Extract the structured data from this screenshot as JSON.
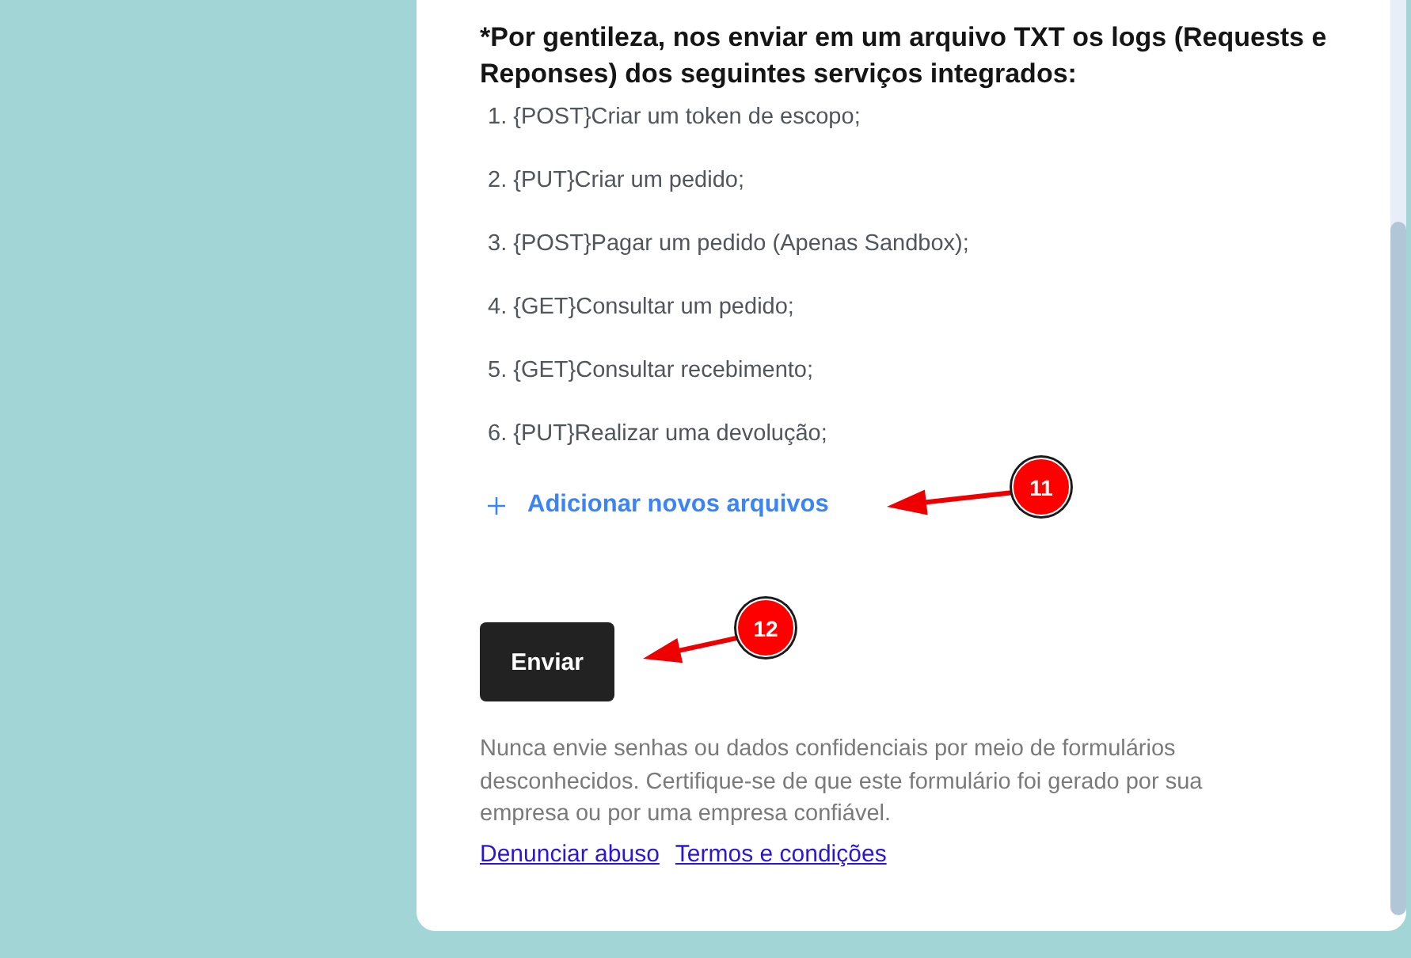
{
  "form": {
    "heading": "*Por gentileza, nos enviar em um arquivo TXT os logs (Requests e Reponses) dos seguintes serviços integrados:",
    "items": [
      "1. {POST}Criar um token de escopo;",
      "2. {PUT}Criar um pedido;",
      "3. {POST}Pagar um pedido (Apenas Sandbox);",
      "4. {GET}Consultar um pedido;",
      "5. {GET}Consultar recebimento;",
      "6. {PUT}Realizar uma devolução;"
    ],
    "add_files": {
      "label": "Adicionar novos arquivos",
      "callout": "11"
    },
    "submit": {
      "label": "Enviar",
      "callout": "12"
    }
  },
  "disclaimer": {
    "text": "Nunca envie senhas ou dados confidenciais por meio de formulários desconhecidos. Certifique-se de que este formulário foi gerado por sua empresa ou por uma empresa confiável.",
    "links": [
      "Denunciar abuso",
      "Termos e condições"
    ]
  }
}
